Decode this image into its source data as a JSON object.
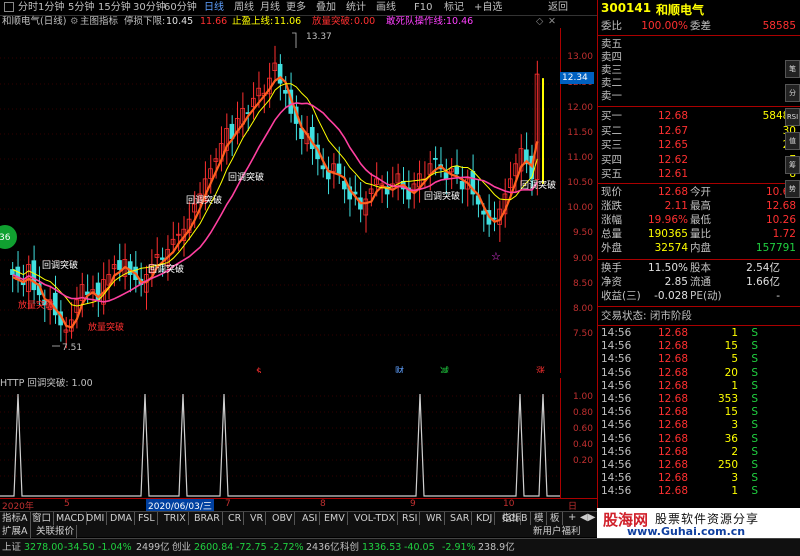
{
  "toolbar": {
    "items": [
      "分时",
      "1分钟",
      "5分钟",
      "15分钟",
      "30分钟",
      "60分钟",
      "日线",
      "周线",
      "月线",
      "更多",
      "叠加",
      "统计",
      "画线",
      "F10",
      "标记",
      "+自选",
      "返回"
    ],
    "active": "日线"
  },
  "info": {
    "stock": "和顺电气(日线)",
    "indicator_label": "主图指标",
    "stop_lower_label": "停损下限:",
    "stop_lower_val": "10.45",
    "val2": "11.66",
    "stop_upper_label": "止盈上线:",
    "stop_upper_val": "11.06",
    "breakout_label": "放量突破:",
    "breakout_val": "0.00",
    "limitup_label": "敢死队操作线:",
    "limitup_val": "10.46"
  },
  "main_yaxis": [
    "13.00",
    "12.50",
    "12.00",
    "11.50",
    "11.00",
    "10.50",
    "10.00",
    "9.50",
    "9.00",
    "8.50",
    "8.00",
    "7.50"
  ],
  "price_tag": "12.34",
  "annotations": {
    "high": "13.37",
    "low": "7.51",
    "a1": "回调突破",
    "a2": "回调突破",
    "a3": "回调突破",
    "a4": "回调突破",
    "a5": "回调突破",
    "a6": "回调突破",
    "b1": "放量突破",
    "b2": "放量突破",
    "left_badge": "36",
    "m1": "$",
    "m2": "财",
    "m3": "减",
    "m4": "涨"
  },
  "sub": {
    "title": "HTTP  回调突破: 1.00",
    "yaxis": [
      "1.00",
      "0.80",
      "0.60",
      "0.40",
      "0.20"
    ]
  },
  "dates": [
    "2020年",
    "5",
    "2020/06/03/三",
    "7",
    "8",
    "9",
    "10",
    "日"
  ],
  "tabs": [
    "指标A",
    "窗口",
    "MACD",
    "DMI",
    "DMA",
    "FSL",
    "TRIX",
    "BRAR",
    "CR",
    "VR",
    "OBV",
    "ASI",
    "EMV",
    "VOL-TDX",
    "RSI",
    "WR",
    "SAR",
    "KDJ",
    "CCI",
    "指标B",
    "模",
    "板"
  ],
  "tabs2": [
    "扩展A",
    "关联报价",
    "新用户福利"
  ],
  "status": {
    "sh_label": "上证",
    "sh_val": "3278.00",
    "sh_chg": "-34.50",
    "sh_pct": "-1.04%",
    "sh_amt": "2499亿",
    "cy_label": "创业",
    "cy_val": "2600.84",
    "cy_chg": "-72.75",
    "cy_pct": "-2.72%",
    "cy_amt": "2436亿",
    "kc_label": "科创",
    "kc_val": "1336.53",
    "kc_chg": "-40.05",
    "kc_pct": "-2.91%",
    "kc_amt": "238.9亿"
  },
  "quote": {
    "code": "300141",
    "name": "和顺电气",
    "weibi_label": "委比",
    "weibi_val": "100.00%",
    "weicha_label": "委差",
    "weicha_val": "58585",
    "sells": [
      "卖五",
      "卖四",
      "卖三",
      "卖二",
      "卖一"
    ],
    "buys": [
      {
        "label": "买一",
        "price": "12.68",
        "vol": "58486"
      },
      {
        "label": "买二",
        "price": "12.67",
        "vol": "30"
      },
      {
        "label": "买三",
        "price": "12.65",
        "vol": "22"
      },
      {
        "label": "买四",
        "price": "12.62",
        "vol": "7"
      },
      {
        "label": "买五",
        "price": "12.61",
        "vol": "8"
      }
    ],
    "stats": [
      {
        "l1": "现价",
        "v1": "12.68",
        "l2": "今开",
        "v2": "10.67"
      },
      {
        "l1": "涨跌",
        "v1": "2.11",
        "l2": "最高",
        "v2": "12.68"
      },
      {
        "l1": "涨幅",
        "v1": "19.96%",
        "l2": "最低",
        "v2": "10.26"
      },
      {
        "l1": "总量",
        "v1": "190365",
        "l2": "量比",
        "v2": "1.72"
      },
      {
        "l1": "外盘",
        "v1": "32574",
        "l2": "内盘",
        "v2": "157791"
      }
    ],
    "stats2": [
      {
        "l1": "换手",
        "v1": "11.50%",
        "l2": "股本",
        "v2": "2.54亿"
      },
      {
        "l1": "净资",
        "v1": "2.85",
        "l2": "流通",
        "v2": "1.66亿"
      },
      {
        "l1": "收益(三)",
        "v1": "-0.028",
        "l2": "PE(动)",
        "v2": "-"
      }
    ],
    "trade_state": "交易状态: 闭市阶段",
    "ticks": [
      {
        "t": "14:56",
        "p": "12.68",
        "v": "1",
        "s": "S"
      },
      {
        "t": "14:56",
        "p": "12.68",
        "v": "15",
        "s": "S"
      },
      {
        "t": "14:56",
        "p": "12.68",
        "v": "5",
        "s": "S"
      },
      {
        "t": "14:56",
        "p": "12.68",
        "v": "20",
        "s": "S"
      },
      {
        "t": "14:56",
        "p": "12.68",
        "v": "1",
        "s": "S"
      },
      {
        "t": "14:56",
        "p": "12.68",
        "v": "353",
        "s": "S"
      },
      {
        "t": "14:56",
        "p": "12.68",
        "v": "15",
        "s": "S"
      },
      {
        "t": "14:56",
        "p": "12.68",
        "v": "3",
        "s": "S"
      },
      {
        "t": "14:56",
        "p": "12.68",
        "v": "36",
        "s": "S"
      },
      {
        "t": "14:56",
        "p": "12.68",
        "v": "2",
        "s": "S"
      },
      {
        "t": "14:56",
        "p": "12.68",
        "v": "250",
        "s": "S"
      },
      {
        "t": "14:56",
        "p": "12.68",
        "v": "3",
        "s": "S"
      },
      {
        "t": "14:56",
        "p": "12.68",
        "v": "1",
        "s": "S"
      }
    ]
  },
  "watermark": {
    "brand": "股海网",
    "slogan": "股票软件资源分享",
    "url": "www.Guhai.com.cn"
  }
}
